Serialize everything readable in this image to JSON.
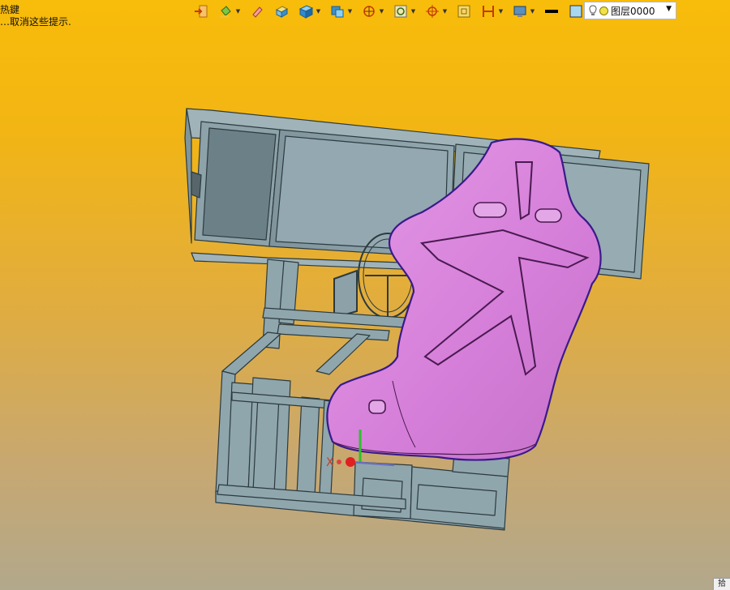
{
  "hint": {
    "line1": "热鍵",
    "line2": "…取消这些提示."
  },
  "toolbar": {
    "buttons": [
      {
        "icon": "import-icon"
      },
      {
        "icon": "paint-bucket-icon",
        "dropdown": true
      },
      {
        "icon": "eraser-icon"
      },
      {
        "icon": "box-shaded-icon"
      },
      {
        "icon": "cube-icon",
        "dropdown": true
      },
      {
        "icon": "view-cube-icon",
        "dropdown": true
      },
      {
        "icon": "rotate-view-icon",
        "dropdown": true
      },
      {
        "icon": "zoom-fit-icon",
        "dropdown": true
      },
      {
        "icon": "pan-target-icon",
        "dropdown": true
      },
      {
        "icon": "zoom-window-icon"
      },
      {
        "icon": "measure-icon",
        "dropdown": true
      },
      {
        "icon": "display-mode-icon",
        "dropdown": true
      },
      {
        "icon": "line-color-icon"
      },
      {
        "icon": "fill-color-icon"
      },
      {
        "icon": "layers-icon",
        "dropdown": true
      }
    ],
    "layer_selector": {
      "value": "图层0000"
    }
  },
  "viewport": {
    "axis_label_x": "X"
  },
  "corner_tab": {
    "label": "拾"
  },
  "colors": {
    "frame": "#8fa6ad",
    "frame_edge": "#2c3a3e",
    "seat": "#d57ed9",
    "seat_edge": "#4a1a50",
    "background_top": "#f8bc0a",
    "background_bottom": "#b2a88c"
  }
}
